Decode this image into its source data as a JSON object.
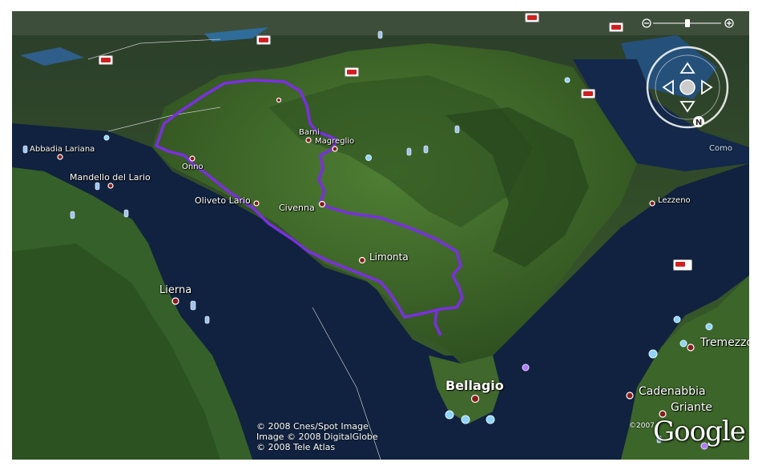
{
  "places": {
    "abbadia": "Abbadia Lariana",
    "mandello": "Mandello del Lario",
    "onno": "Onno",
    "barni": "Barni",
    "magreglio": "Magreglio",
    "oliveto": "Oliveto Lario",
    "civenna": "Civenna",
    "limonta": "Limonta",
    "lezzeno": "Lezzeno",
    "lierna": "Lierna",
    "bellagio": "Bellagio",
    "cadenabbia": "Cadenabbia",
    "griante": "Griante",
    "tremezzo": "Tremezzo",
    "como": "Como"
  },
  "credits": {
    "line1": "© 2008 Cnes/Spot Image",
    "line2": "Image © 2008 DigitalGlobe",
    "line3": "© 2008 Tele Atlas"
  },
  "copyright_year": "©2007",
  "logo_text": "Google",
  "colors": {
    "route": "#7b2fe0",
    "lake": "#10223f",
    "terrain": "#3f6a2c",
    "terrain_dark": "#22401a",
    "place_marker": "#8a1b1b"
  },
  "icons": [
    "navigation-compass-icon",
    "zoom-slider-icon",
    "youtube-layer-icon",
    "photo-layer-icon",
    "person-layer-icon"
  ]
}
